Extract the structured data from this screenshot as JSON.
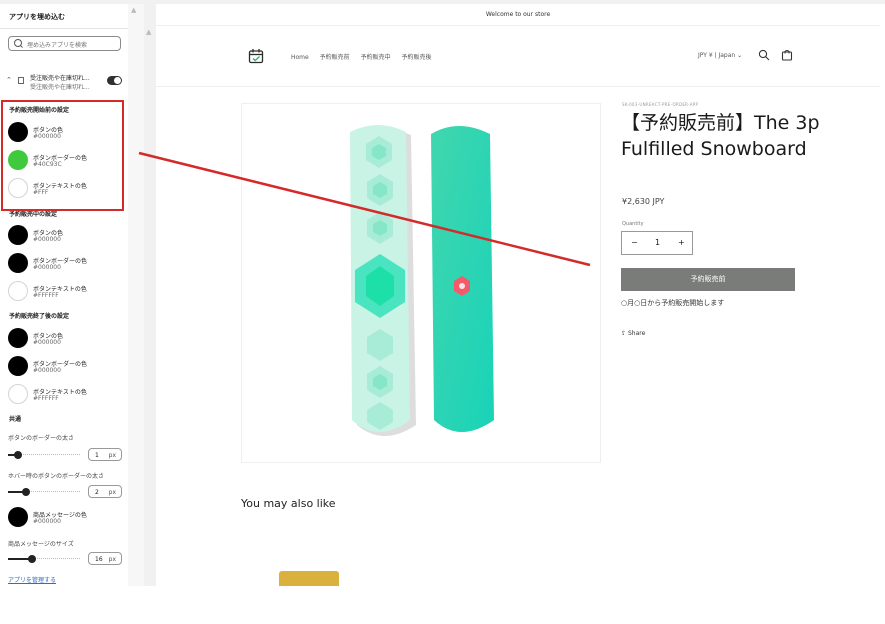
{
  "sidebar": {
    "title": "アプリを埋め込む",
    "search_placeholder": "埋め込みアプリを検索",
    "app": {
      "name": "受注販売や在庫切れ...",
      "subtitle": "受注販売や在庫切れ..."
    },
    "sections": [
      {
        "title": "予約販売開始前の設定",
        "items": [
          {
            "label": "ボタンの色",
            "hex": "#000000",
            "color": "#000000"
          },
          {
            "label": "ボタンボーダーの色",
            "hex": "#40C93C",
            "color": "#40c93c"
          },
          {
            "label": "ボタンテキストの色",
            "hex": "#FFF",
            "color": "#ffffff"
          }
        ]
      },
      {
        "title": "予約販売中の設定",
        "items": [
          {
            "label": "ボタンの色",
            "hex": "#000000",
            "color": "#000000"
          },
          {
            "label": "ボタンボーダーの色",
            "hex": "#000000",
            "color": "#000000"
          },
          {
            "label": "ボタンテキストの色",
            "hex": "#FFFFFF",
            "color": "#ffffff"
          }
        ]
      },
      {
        "title": "予約販売終了後の設定",
        "items": [
          {
            "label": "ボタンの色",
            "hex": "#000000",
            "color": "#000000"
          },
          {
            "label": "ボタンボーダーの色",
            "hex": "#000000",
            "color": "#000000"
          },
          {
            "label": "ボタンテキストの色",
            "hex": "#FFFFFF",
            "color": "#ffffff"
          }
        ]
      }
    ],
    "common": {
      "title": "共通",
      "border_width_label": "ボタンのボーダーの太さ",
      "border_width_value": "1",
      "hover_border_label": "ホバー時のボタンのボーダーの太さ",
      "hover_border_value": "2",
      "message_color_label": "商品メッセージの色",
      "message_color_hex": "#000000",
      "message_size_label": "商品メッセージのサイズ",
      "message_size_value": "16",
      "unit": "px"
    },
    "manage_link": "アプリを管理する"
  },
  "store": {
    "announcement": "Welcome to our store",
    "nav": [
      "Home",
      "予約販売前",
      "予約販売中",
      "予約販売後"
    ],
    "currency": "JPY ¥ | Japan",
    "product": {
      "sku": "SK-003-UNREACT-PRE-ORDER-APP",
      "title": "【予約販売前】The 3p Fulfilled Snowboard",
      "price": "¥2,630 JPY",
      "quantity_label": "Quantity",
      "quantity": "1",
      "minus": "−",
      "plus": "+",
      "button": "予約販売前",
      "notice": "○月○日から予約販売開始します",
      "share": "Share"
    },
    "related_title": "You may also like"
  },
  "colors": {
    "annotation_red": "#d42a2a",
    "link_blue": "#2c6ecb",
    "button_gray": "#7a7c79"
  }
}
